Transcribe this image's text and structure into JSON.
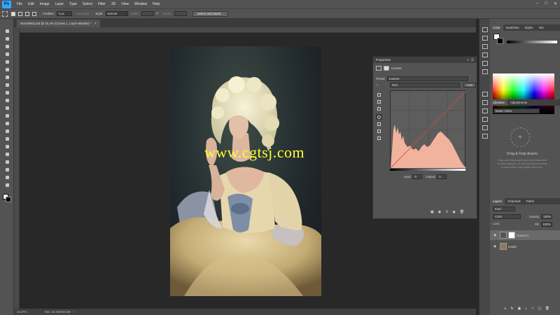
{
  "app": {
    "logo": "Ps"
  },
  "menu": [
    "File",
    "Edit",
    "Image",
    "Layer",
    "Type",
    "Select",
    "Filter",
    "3D",
    "View",
    "Window",
    "Help"
  ],
  "options_bar": {
    "feather_label": "Feather:",
    "feather_value": "0 px",
    "antialias_label": "Anti-alias",
    "style_label": "Style:",
    "style_value": "Normal",
    "width_label": "Width:",
    "height_label": "Height:",
    "select_mask_label": "Select and Mask..."
  },
  "document": {
    "tab_title": "HISA9949.psd @ 15.2% (Curves 1, Layer Mask/8) *",
    "zoom_status": "15.27%",
    "doc_status": "Doc: 33.4M/163.2M"
  },
  "watermark": "www.cgtsj.com",
  "properties": {
    "title": "Properties",
    "adjustment_name": "Curves",
    "preset_label": "Preset:",
    "preset_value": "Custom",
    "channel_value": "Red",
    "auto_label": "Auto",
    "input_label": "Input:",
    "input_value": "0",
    "output_label": "Output:",
    "output_value": "0"
  },
  "color_panel": {
    "tabs": [
      "Color",
      "Swatches",
      "Styles",
      "Info"
    ]
  },
  "libraries": {
    "tabs": [
      "Libraries",
      "Adjustments"
    ],
    "library_select": "Music Video",
    "drag_title": "Drag & Drop Assets",
    "drag_text": "Drag and drop anything in your document to add a graphic, or use the buttons below to add colors, type styles and more."
  },
  "layers_panel": {
    "tabs": [
      "Layers",
      "Channels",
      "Paths"
    ],
    "kind_label": "Kind",
    "blend_mode": "Color",
    "opacity_label": "Opacity:",
    "opacity_value": "100%",
    "lock_label": "Lock:",
    "fill_label": "Fill:",
    "fill_value": "100%",
    "layers": [
      {
        "name": "Curves 1"
      },
      {
        "name": "model"
      }
    ]
  },
  "colors": {
    "panel_bg": "#535353",
    "dark_bg": "#282828",
    "curve_fill": "#f2b39e",
    "accent": "#31a8ff"
  }
}
